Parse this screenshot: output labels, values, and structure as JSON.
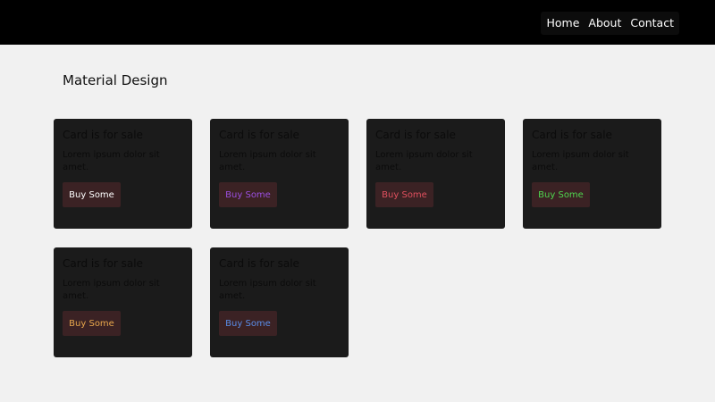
{
  "nav": {
    "items": [
      "Home",
      "About",
      "Contact"
    ]
  },
  "page": {
    "title": "Material Design"
  },
  "cards": [
    {
      "title": "Card is for sale",
      "text": "Lorem ipsum dolor sit amet.",
      "button": "Buy Some",
      "button_color": "#ffffff"
    },
    {
      "title": "Card is for sale",
      "text": "Lorem ipsum dolor sit amet.",
      "button": "Buy Some",
      "button_color": "#9b4fe0"
    },
    {
      "title": "Card is for sale",
      "text": "Lorem ipsum dolor sit amet.",
      "button": "Buy Some",
      "button_color": "#e0505e"
    },
    {
      "title": "Card is for sale",
      "text": "Lorem ipsum dolor sit amet.",
      "button": "Buy Some",
      "button_color": "#4fd64f"
    },
    {
      "title": "Card is for sale",
      "text": "Lorem ipsum dolor sit amet.",
      "button": "Buy Some",
      "button_color": "#e8a64c"
    },
    {
      "title": "Card is for sale",
      "text": "Lorem ipsum dolor sit amet.",
      "button": "Buy Some",
      "button_color": "#5a8de8"
    }
  ],
  "colors": {
    "topbar": "#000000",
    "background": "#f1f1f1",
    "card": "#1b1b1b",
    "button_bg": "#3b2224"
  }
}
